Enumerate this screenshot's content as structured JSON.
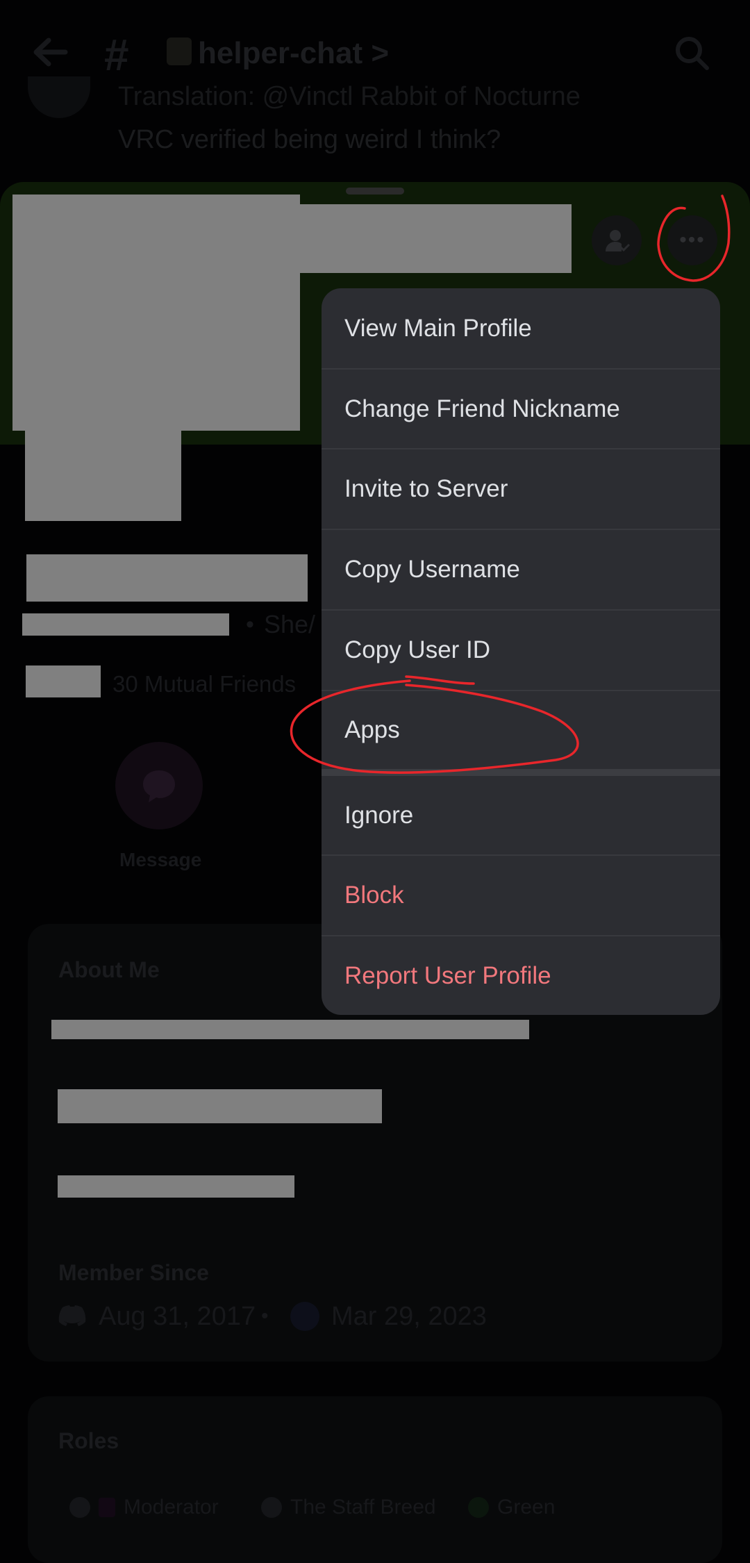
{
  "header": {
    "channel_name": "helper-chat",
    "channel_chevron": ">",
    "hash": "#"
  },
  "message": {
    "line1": "Translation: @Vinctl Rabbit of Nocturne",
    "line2": "VRC verified being weird I think?"
  },
  "profile": {
    "pronouns": "She/",
    "separator": "•",
    "mutual_friends": "30 Mutual Friends",
    "message_label": "Message"
  },
  "about": {
    "title": "About Me"
  },
  "member_since": {
    "title": "Member Since",
    "discord_date": "Aug 31, 2017",
    "dot": "•",
    "server_date": "Mar 29, 2023"
  },
  "roles": {
    "title": "Roles",
    "items": [
      {
        "label": "Moderator"
      },
      {
        "label": "The Staff Breed"
      },
      {
        "label": "Green"
      }
    ]
  },
  "menu": {
    "items": [
      {
        "label": "View Main Profile"
      },
      {
        "label": "Change Friend Nickname"
      },
      {
        "label": "Invite to Server"
      },
      {
        "label": "Copy Username"
      },
      {
        "label": "Copy User ID"
      },
      {
        "label": "Apps"
      },
      {
        "label": "Ignore"
      },
      {
        "label": "Block"
      },
      {
        "label": "Report User Profile"
      }
    ]
  },
  "colors": {
    "menu_bg": "#2c2d32",
    "danger": "#f2787d",
    "annotation": "#e8262b"
  }
}
